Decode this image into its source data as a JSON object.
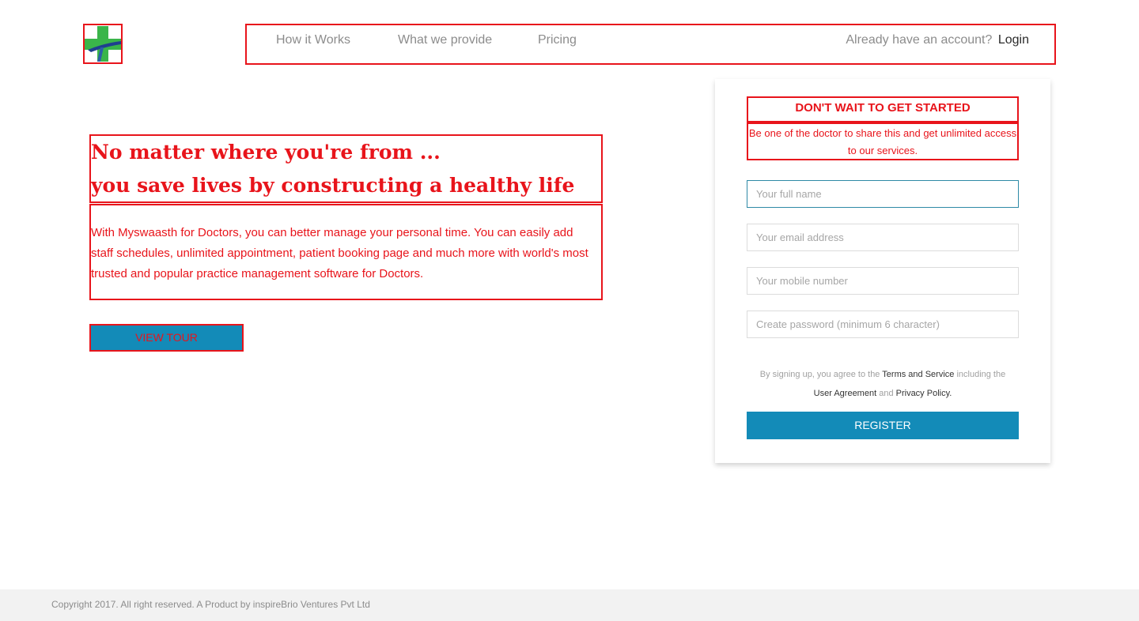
{
  "logo": {
    "icon": "medical-cross-logo-icon",
    "colors": {
      "cross": "#3ab54a",
      "swoosh": "#1f3f8f"
    }
  },
  "nav": {
    "links": [
      "How it Works",
      "What we provide",
      "Pricing"
    ],
    "account_prompt": "Already have an account?",
    "login_label": "Login"
  },
  "hero": {
    "title_line1": "No matter where you're from ...",
    "title_line2": "you save lives by constructing a healthy life",
    "description": "With Myswaasth for Doctors, you can better manage your personal time. You can easily add staff schedules, unlimited appointment, patient booking page and much more with world's most trusted and popular practice management software for Doctors.",
    "tour_button": "VIEW TOUR"
  },
  "signup": {
    "heading": "DON'T WAIT TO GET STARTED",
    "subheading": "Be one of the doctor to share this and get unlimited access to our services.",
    "fields": {
      "full_name": {
        "placeholder": "Your full name",
        "value": ""
      },
      "email": {
        "placeholder": "Your email address",
        "value": ""
      },
      "mobile": {
        "placeholder": "Your mobile number",
        "value": ""
      },
      "password": {
        "placeholder": "Create password (minimum 6 character)",
        "value": ""
      }
    },
    "terms": {
      "prefix": "By signing up, you agree to the",
      "terms_link": "Terms and Service",
      "middle": "including the",
      "agreement_link": "User Agreement",
      "and": "and",
      "privacy_link": "Privacy Policy."
    },
    "register_button": "REGISTER"
  },
  "footer": {
    "copyright": "Copyright 2017. All right reserved. A Product by inspireBrio Ventures Pvt Ltd"
  },
  "colors": {
    "accent": "#138bb8",
    "highlight_border": "#e8141b",
    "footer_bg": "#f2f2f2"
  }
}
